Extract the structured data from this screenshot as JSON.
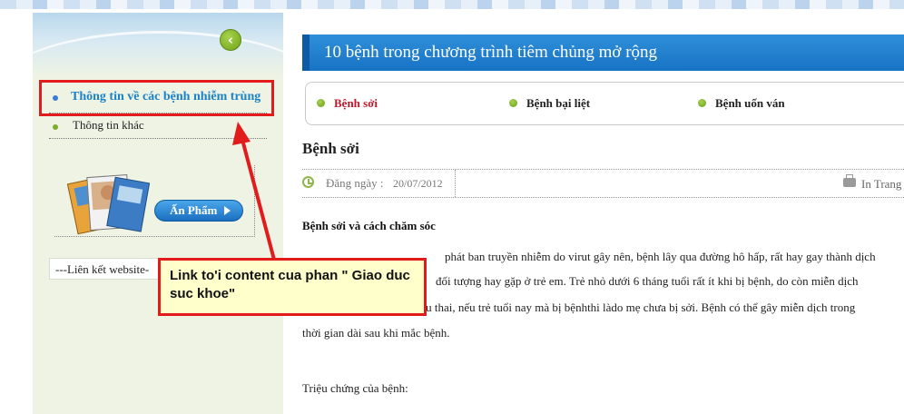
{
  "sidebar": {
    "back_icon": "chevron-left-icon",
    "menu": [
      {
        "label": "Thông tin về các bệnh nhiễm trùng"
      },
      {
        "label": "Thông tin khác"
      }
    ],
    "publication_button": "Ấn Phẩm",
    "links_label": "---Liên kết website-"
  },
  "main": {
    "section_title": "10 bệnh trong chương trình tiêm chủng mở rộng",
    "tabs": [
      {
        "label": "Bệnh sởi",
        "active": true
      },
      {
        "label": "Bệnh bại liệt",
        "active": false
      },
      {
        "label": "Bệnh uốn ván",
        "active": false
      }
    ],
    "article": {
      "title": "Bệnh sởi",
      "date_label": "Đăng ngày :",
      "date_value": "20/07/2012",
      "print_label": "In Trang",
      "heading": "Bệnh sởi và cách chăm sóc",
      "lines": [
        "phát ban truyền nhiễm do virut gây nên, bệnh lây qua đường hô hấp, rất hay gay thành dịch",
        "đối tượng hay gặp ở trẻ em. Trẻ nhỏ dưới 6 tháng tuổi rất ít khi bị bệnh, do còn miễn dịch",
        "của mẹ truyền sang qua rau thai, nếu trẻ tuổi nay mà bị bệnhthi làdo mẹ chưa bị sởi. Bệnh có thể gây miễn dịch trong",
        "thời gian dài sau khi mắc bệnh."
      ],
      "symptom_label": "Triệu chứng của bệnh:"
    }
  },
  "annotation": {
    "callout_text": "Link to'i content cua phan \" Giao duc suc khoe\"",
    "color": "#e21c1c"
  },
  "colors": {
    "accent_blue": "#1873c4",
    "active_tab": "#c0182c",
    "bullet_green": "#7cad2a"
  }
}
